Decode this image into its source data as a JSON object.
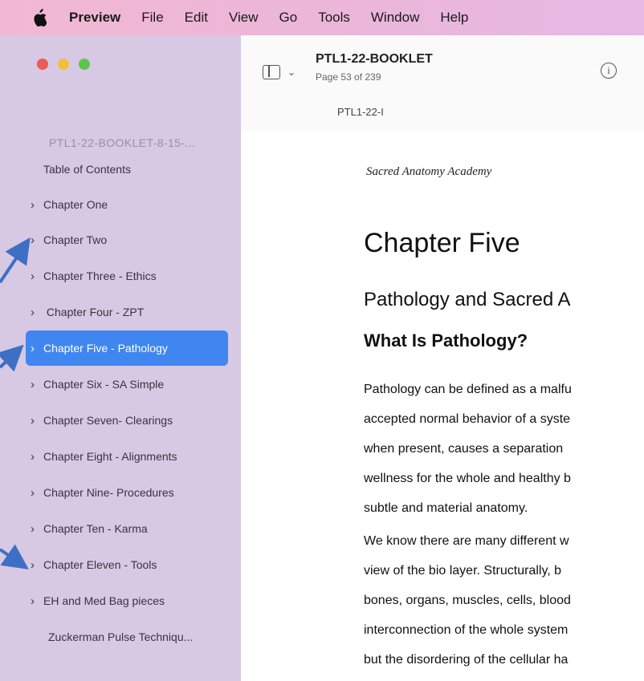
{
  "menubar": {
    "app_name": "Preview",
    "items": [
      "File",
      "Edit",
      "View",
      "Go",
      "Tools",
      "Window",
      "Help"
    ]
  },
  "window": {
    "traffic_lights": {
      "close": "#ed5b55",
      "minimize": "#f3be3c",
      "zoom": "#5dc44c"
    }
  },
  "sidebar": {
    "document_name": "PTL1-22-BOOKLET-8-15-...",
    "items": [
      {
        "label": "Table of Contents",
        "has_chevron": false,
        "selected": false
      },
      {
        "label": "Chapter One",
        "has_chevron": true,
        "selected": false
      },
      {
        "label": "Chapter Two",
        "has_chevron": true,
        "selected": false
      },
      {
        "label": "Chapter Three - Ethics",
        "has_chevron": true,
        "selected": false
      },
      {
        "label": " Chapter Four - ZPT",
        "has_chevron": true,
        "selected": false
      },
      {
        "label": "Chapter Five - Pathology",
        "has_chevron": true,
        "selected": true
      },
      {
        "label": "Chapter Six - SA Simple",
        "has_chevron": true,
        "selected": false
      },
      {
        "label": "Chapter Seven- Clearings",
        "has_chevron": true,
        "selected": false
      },
      {
        "label": "Chapter Eight - Alignments",
        "has_chevron": true,
        "selected": false
      },
      {
        "label": "Chapter Nine- Procedures",
        "has_chevron": true,
        "selected": false
      },
      {
        "label": "Chapter Ten - Karma",
        "has_chevron": true,
        "selected": false
      },
      {
        "label": "Chapter Eleven - Tools",
        "has_chevron": true,
        "selected": false
      },
      {
        "label": "EH and Med Bag pieces",
        "has_chevron": true,
        "selected": false
      },
      {
        "label": "Zuckerman Pulse Techniqu...",
        "has_chevron": false,
        "selected": false
      }
    ]
  },
  "toolbar": {
    "title": "PTL1-22-BOOKLET",
    "page_info": "Page 53 of 239",
    "tab_title": "PTL1-22-I"
  },
  "document": {
    "header": "Sacred Anatomy Academy",
    "chapter_title": "Chapter Five",
    "subtitle": "Pathology and Sacred A",
    "section_heading": "What Is Pathology?",
    "paragraph1": [
      "Pathology can be defined as a malfu",
      "accepted normal behavior of a syste",
      "when present, causes a separation",
      "wellness for the whole and healthy b",
      "subtle and material anatomy."
    ],
    "paragraph2": [
      "We know there are many different w",
      "view of the bio layer.  Structurally, b",
      "bones, organs, muscles, cells, blood",
      "interconnection of the whole system",
      "but the disordering of the cellular ha"
    ]
  },
  "colors": {
    "selection": "#3f86f0",
    "arrow": "#3d6fc4",
    "sidebar_bg": "#d7c8e3"
  }
}
